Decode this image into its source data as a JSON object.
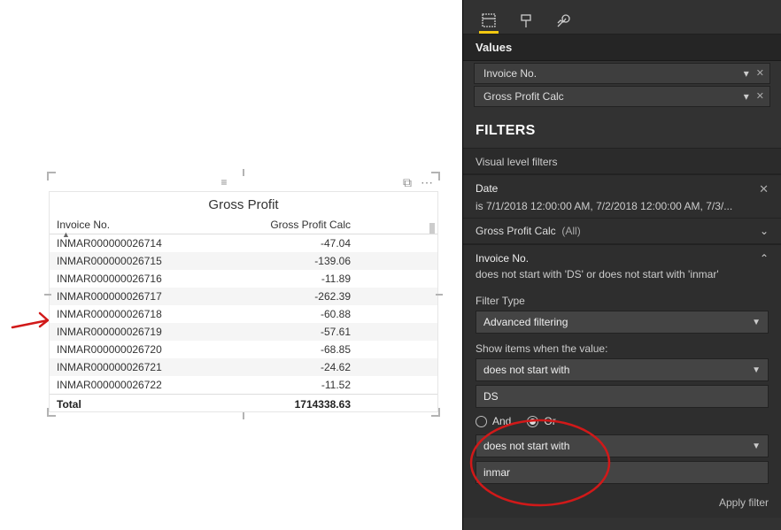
{
  "table": {
    "title": "Gross Profit",
    "columns": {
      "c1": "Invoice No.",
      "c2": "Gross Profit Calc"
    },
    "rows": [
      {
        "c1": "INMAR000000026714",
        "c2": "-47.04"
      },
      {
        "c1": "INMAR000000026715",
        "c2": "-139.06"
      },
      {
        "c1": "INMAR000000026716",
        "c2": "-11.89"
      },
      {
        "c1": "INMAR000000026717",
        "c2": "-262.39"
      },
      {
        "c1": "INMAR000000026718",
        "c2": "-60.88"
      },
      {
        "c1": "INMAR000000026719",
        "c2": "-57.61"
      },
      {
        "c1": "INMAR000000026720",
        "c2": "-68.85"
      },
      {
        "c1": "INMAR000000026721",
        "c2": "-24.62"
      },
      {
        "c1": "INMAR000000026722",
        "c2": "-11.52"
      }
    ],
    "footer": {
      "label": "Total",
      "value": "1714338.63"
    }
  },
  "panel": {
    "values_label": "Values",
    "fields": [
      {
        "name": "Invoice No."
      },
      {
        "name": "Gross Profit Calc"
      }
    ],
    "filters_title": "FILTERS",
    "visual_filters_label": "Visual level filters",
    "cards": {
      "date": {
        "title": "Date",
        "summary": "is 7/1/2018 12:00:00 AM, 7/2/2018 12:00:00 AM, 7/3/..."
      },
      "gpc": {
        "title": "Gross Profit Calc",
        "all": "(All)"
      },
      "invoice": {
        "title": "Invoice No.",
        "summary": "does not start with 'DS' or does not start with 'inmar'",
        "filter_type_label": "Filter Type",
        "filter_type": "Advanced filtering",
        "show_items_label": "Show items when the value:",
        "cond1_op": "does not start with",
        "cond1_val": "DS",
        "logic_and": "And",
        "logic_or": "Or",
        "cond2_op": "does not start with",
        "cond2_val": "inmar",
        "apply": "Apply filter"
      }
    }
  }
}
